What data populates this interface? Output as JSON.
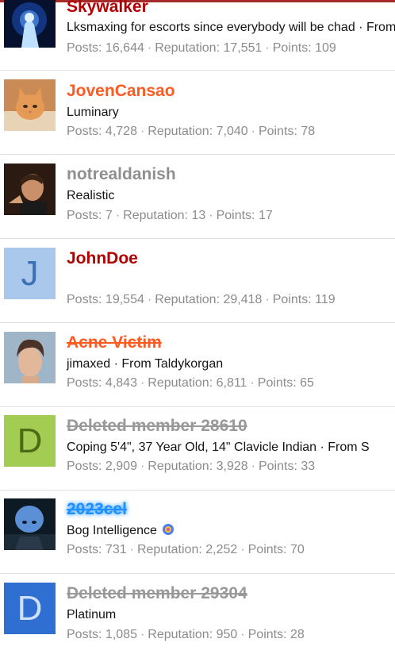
{
  "members": [
    {
      "username": "Skywalker",
      "user_title": "Lksmaxing for escorts since everybody will be chad · From Ohio",
      "avatar": "photo-jedi-silhouette-blue-icon",
      "username_color": "#b30000",
      "posts_label": "Posts:",
      "posts": "16,644",
      "rep_label": "Reputation:",
      "reputation": "17,551",
      "points_label": "Points:",
      "points": "109"
    },
    {
      "username": "JovenCansao",
      "user_title": "Luminary",
      "avatar": "photo-cat-icon",
      "username_color": "#ff5a1f",
      "posts_label": "Posts:",
      "posts": "4,728",
      "rep_label": "Reputation:",
      "reputation": "7,040",
      "points_label": "Points:",
      "points": "78"
    },
    {
      "username": "notrealdanish",
      "user_title": "Realistic",
      "avatar": "photo-man-portrait-icon",
      "username_color": "#8f8f8f",
      "posts_label": "Posts:",
      "posts": "7",
      "rep_label": "Reputation:",
      "reputation": "13",
      "points_label": "Points:",
      "points": "17"
    },
    {
      "username": "JohnDoe",
      "user_title": "",
      "avatar_letter": "J",
      "avatar_bg": "#a9c8ec",
      "avatar_fg": "#3b6fb6",
      "username_color": "#b30000",
      "posts_label": "Posts:",
      "posts": "19,554",
      "rep_label": "Reputation:",
      "reputation": "29,418",
      "points_label": "Points:",
      "points": "119"
    },
    {
      "username": "Acne Victim",
      "user_title": "jimaxed · From Taldykorgan",
      "avatar": "photo-young-man-icon",
      "username_color": "#ff5a1f",
      "posts_label": "Posts:",
      "posts": "4,843",
      "rep_label": "Reputation:",
      "reputation": "6,811",
      "points_label": "Points:",
      "points": "65"
    },
    {
      "username": "Deleted member 28610",
      "user_title": "Coping 5'4\", 37 Year Old, 14\" Clavicle Indian · From S",
      "avatar_letter": "D",
      "avatar_bg": "#a3cc52",
      "avatar_fg": "#4d6a14",
      "username_color": "#999999",
      "posts_label": "Posts:",
      "posts": "2,909",
      "rep_label": "Reputation:",
      "reputation": "3,928",
      "points_label": "Points:",
      "points": "33"
    },
    {
      "username": "2023cel",
      "user_title": "Bog Intelligence",
      "avatar": "photo-megamind-icon",
      "username_color": "#1e90ff",
      "posts_label": "Posts:",
      "posts": "731",
      "rep_label": "Reputation:",
      "reputation": "2,252",
      "points_label": "Points:",
      "points": "70"
    },
    {
      "username": "Deleted member 29304",
      "user_title": "Platinum",
      "avatar_letter": "D",
      "avatar_bg": "#2f6fd1",
      "avatar_fg": "#cfe0fa",
      "username_color": "#999999",
      "posts_label": "Posts:",
      "posts": "1,085",
      "rep_label": "Reputation:",
      "reputation": "950",
      "points_label": "Points:",
      "points": "28"
    }
  ]
}
